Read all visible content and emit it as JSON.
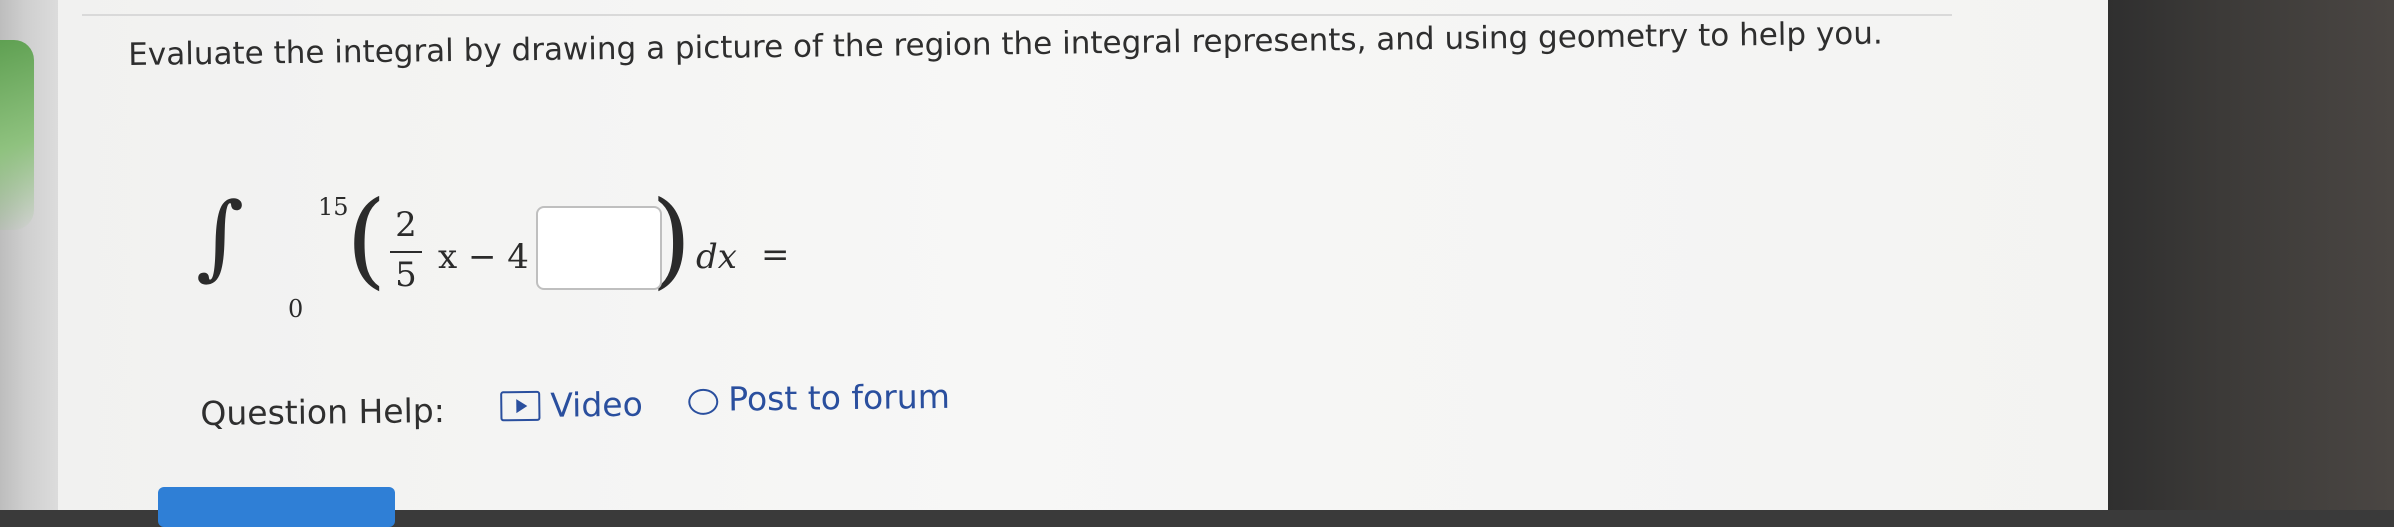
{
  "question": {
    "prompt": "Evaluate the integral by drawing a picture of the region the integral represents, and using geometry to help you."
  },
  "integral": {
    "upper_limit": "15",
    "lower_limit": "0",
    "fraction_numerator": "2",
    "fraction_denominator": "5",
    "integrand_rest": "x − 4",
    "differential": "dx",
    "equals": "=",
    "answer_value": ""
  },
  "help": {
    "label": "Question Help:",
    "video_label": "Video",
    "forum_label": "Post to forum"
  },
  "colors": {
    "link": "#2a4f9e",
    "submit_button": "#2f7fd6"
  }
}
